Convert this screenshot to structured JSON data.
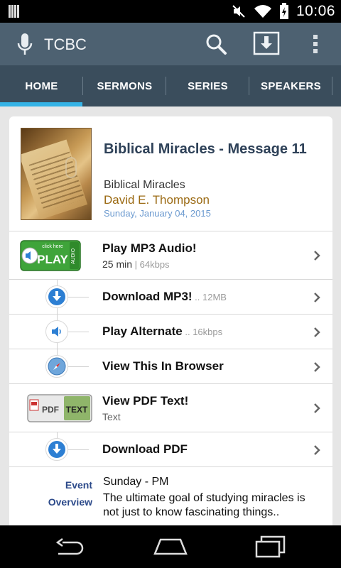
{
  "status_bar": {
    "time": "10:06"
  },
  "app": {
    "title": "TCBC"
  },
  "tabs": [
    {
      "label": "HOME",
      "active": true
    },
    {
      "label": "SERMONS"
    },
    {
      "label": "SERIES"
    },
    {
      "label": "SPEAKERS"
    }
  ],
  "sermon": {
    "title": "Biblical Miracles - Message 11",
    "series": "Biblical Miracles",
    "speaker": "David E. Thompson",
    "date": "Sunday, January 04, 2015"
  },
  "play_badge": {
    "top": "click here",
    "main": "PLAY",
    "side": "AUDIO"
  },
  "pdf_badge": {
    "left": "PDF",
    "right": "TEXT"
  },
  "actions": {
    "play_mp3": {
      "label": "Play MP3 Audio!",
      "duration": "25 min",
      "sep": " | ",
      "bitrate": "64kbps"
    },
    "download_mp3": {
      "label": "Download MP3!",
      "size": " .. 12MB"
    },
    "play_alternate": {
      "label": "Play Alternate",
      "bitrate": " .. 16kbps"
    },
    "view_browser": {
      "label": "View This In Browser"
    },
    "view_pdf": {
      "label": "View PDF Text!",
      "sub": "Text"
    },
    "download_pdf": {
      "label": "Download PDF"
    }
  },
  "event": {
    "event_key": "Event",
    "event_value": "Sunday - PM",
    "overview_key": "Overview",
    "overview_value": "The ultimate goal of studying miracles is not just to know fascinating things.."
  },
  "colors": {
    "actionbar": "#4d6171",
    "tabbar": "#3a4d5c",
    "tab_indicator": "#35b3e6",
    "title": "#2e4158",
    "speaker": "#9b6a13",
    "date": "#6d9bd0",
    "play_green": "#3fa43a",
    "blue_circle": "#2d7fd3"
  }
}
